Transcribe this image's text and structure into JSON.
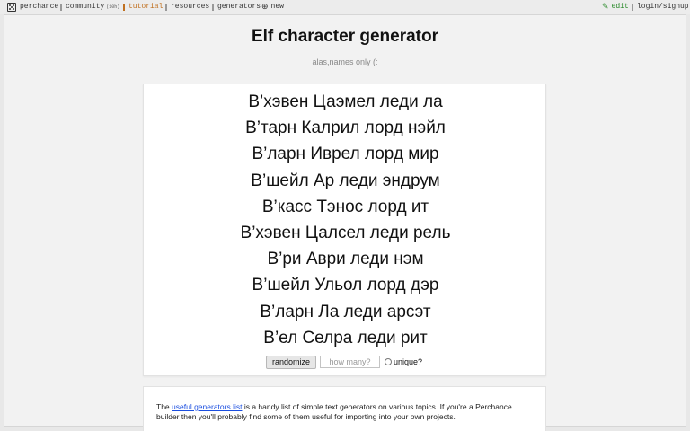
{
  "nav": {
    "perchance": "perchance",
    "community": "community",
    "community_count": "(10h)",
    "tutorial": "tutorial",
    "resources": "resources",
    "generators": "generators",
    "new": "new",
    "edit": "edit",
    "login": "login/signup"
  },
  "page": {
    "title": "Elf character generator",
    "subtitle": "alas,names only (:"
  },
  "names": [
    "В’хэвен Цаэмел леди ла",
    "В’тарн Калрил лорд нэйл",
    "В’ларн Иврел лорд мир",
    "В’шейл Ар леди эндрум",
    "В’касс Тэнос лорд ит",
    "В’хэвен Цалсел леди рель",
    "В’ри Аври леди нэм",
    "В’шейл Ульол лорд дэр",
    "В’ларн Ла леди арсэт",
    "В’ел Селра леди рит"
  ],
  "controls": {
    "randomize_label": "randomize",
    "how_many_placeholder": "how many?",
    "unique_label": "unique?"
  },
  "info": {
    "prefix": "The",
    "link_text": "useful generators list",
    "text": "is a handy list of simple text generators on various topics. If you're a Perchance builder then you'll probably find some of them useful for importing into your own projects."
  },
  "colors": {
    "tutorial_accent": "#c07020",
    "edit_accent": "#2a8a2a",
    "link": "#1a4ee0"
  }
}
